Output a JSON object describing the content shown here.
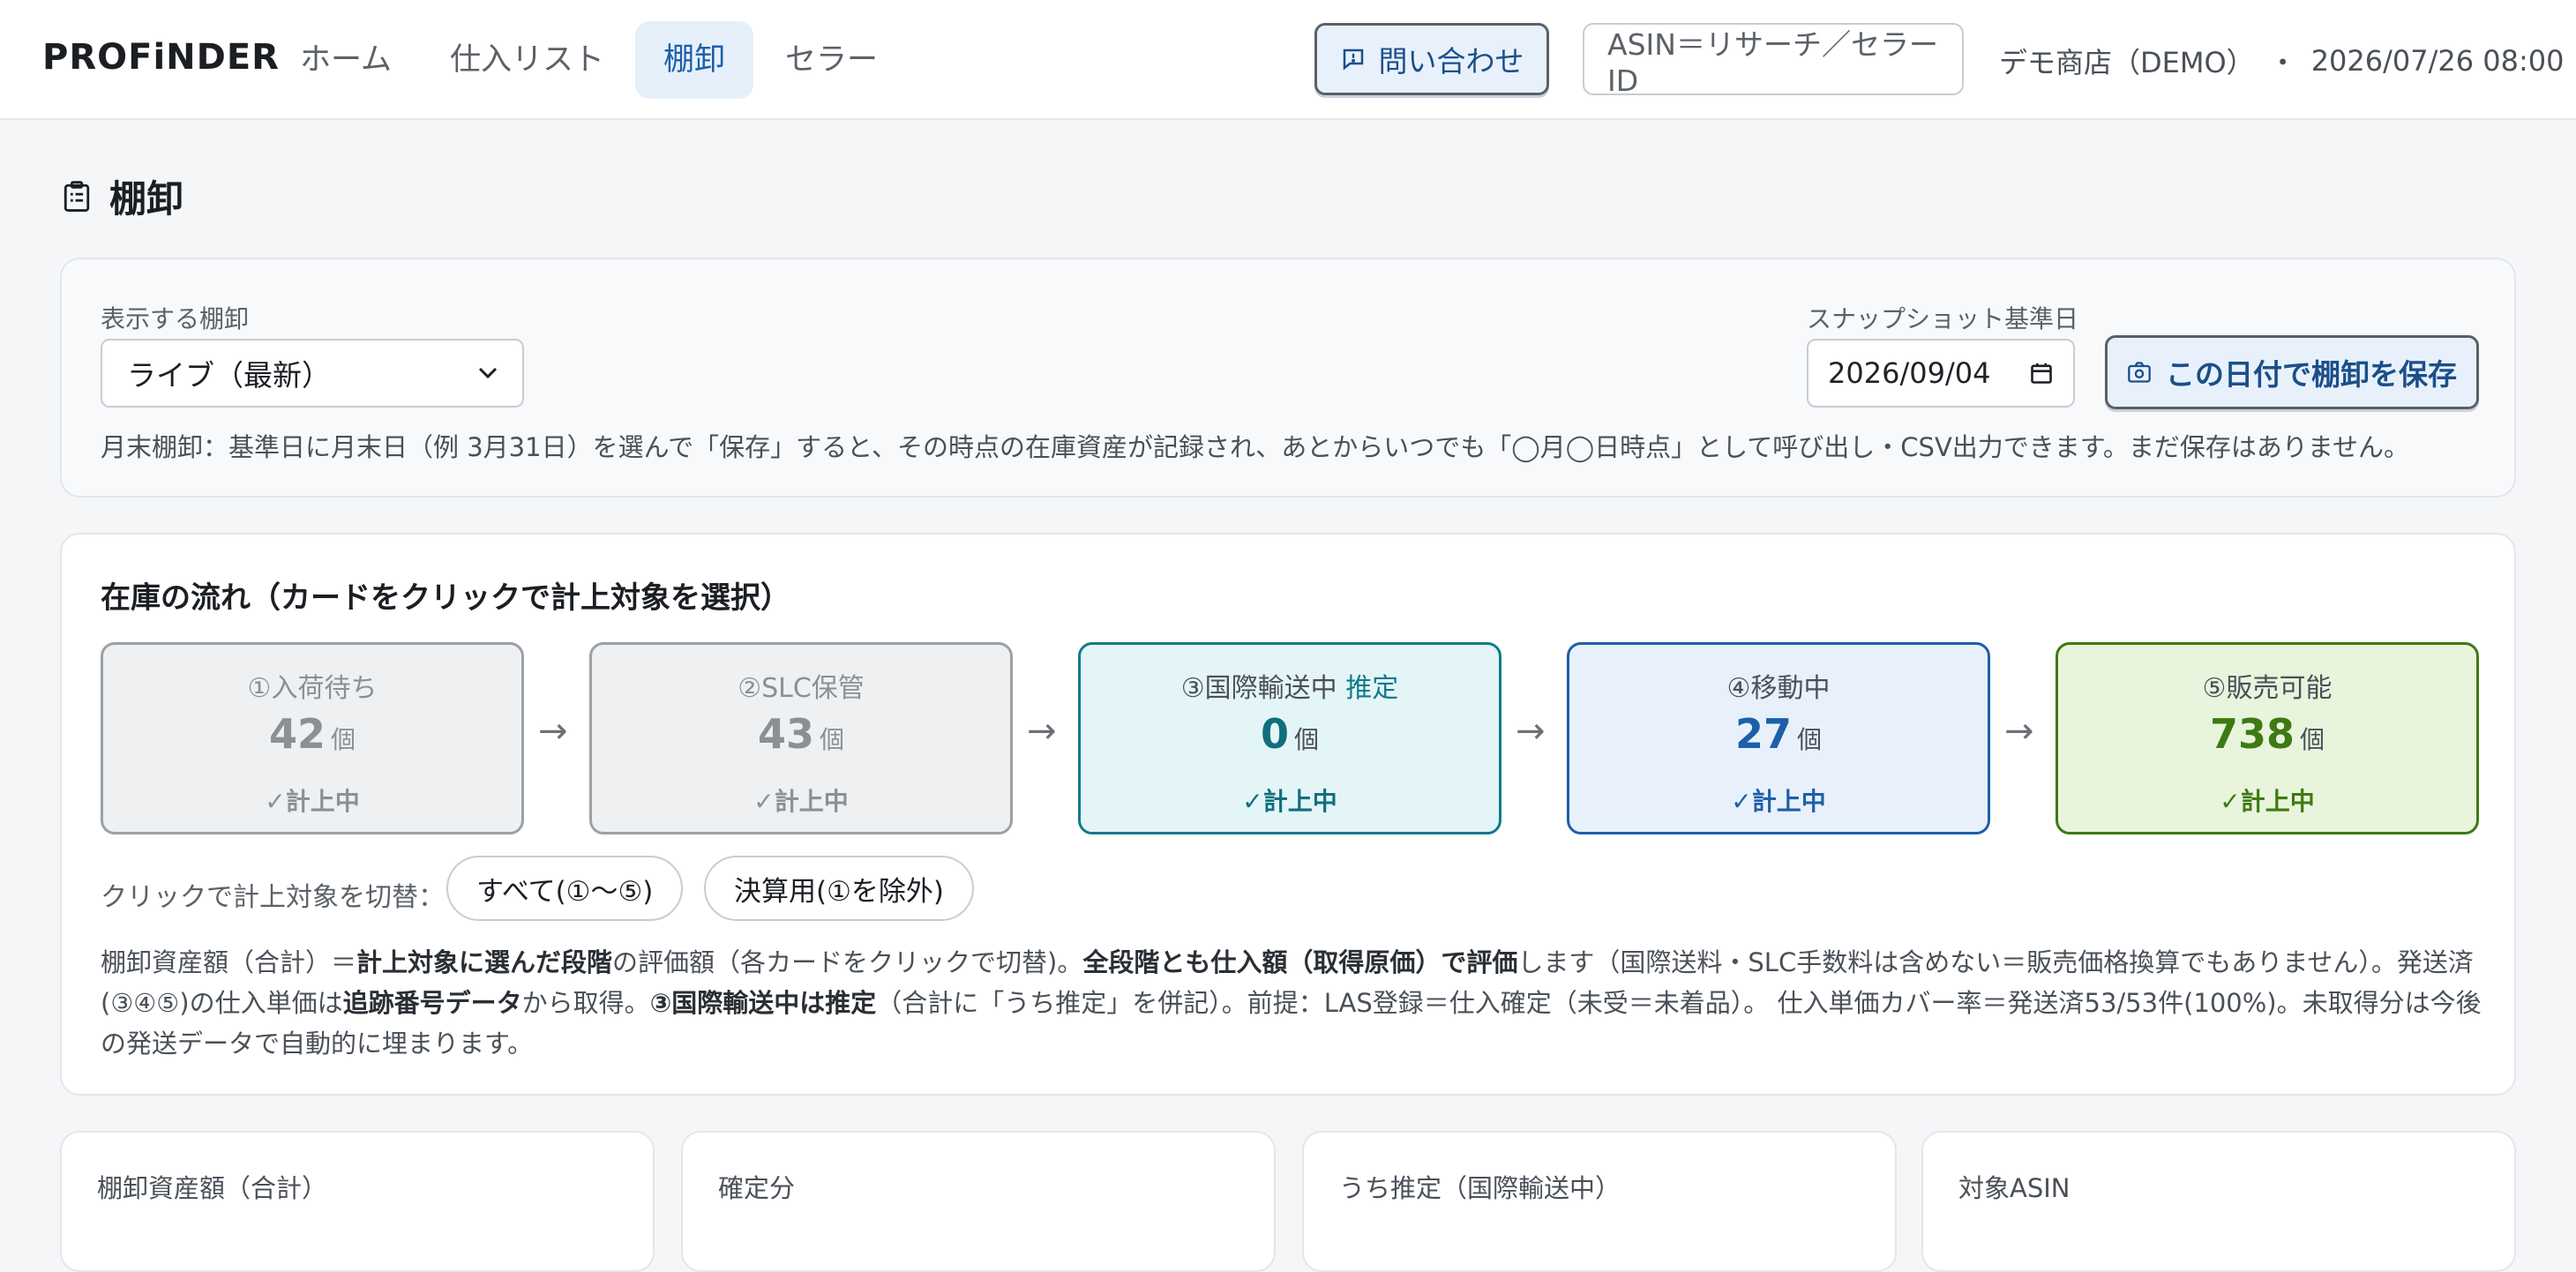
{
  "nav": {
    "logo": "PROFiNDER",
    "items": [
      {
        "label": "ホーム"
      },
      {
        "label": "仕入リスト"
      },
      {
        "label": "棚卸"
      },
      {
        "label": "セラー"
      }
    ],
    "contact_button": "問い合わせ",
    "search_placeholder": "ASIN＝リサーチ／セラーID",
    "shop": "デモ商店（DEMO）",
    "separator": "・",
    "datetime": "2026/07/26 08:00"
  },
  "page": {
    "title": "棚卸"
  },
  "snapshot_panel": {
    "view_label": "表示する棚卸",
    "view_selected": "ライブ（最新）",
    "date_label": "スナップショット基準日",
    "date_value": "2026/09/04",
    "save_button": "この日付で棚卸を保存",
    "note": "月末棚卸：基準日に月末日（例 3月31日）を選んで「保存」すると、その時点の在庫資産が記録され、あとからいつでも「◯月◯日時点」として呼び出し・CSV出力できます。まだ保存はありません。"
  },
  "flow_panel": {
    "title": "在庫の流れ（カードをクリックで計上対象を選択）",
    "unit": "個",
    "stages": [
      {
        "name": "①入荷待ち",
        "estimate_tag": "",
        "count": "42",
        "status": "✓計上中"
      },
      {
        "name": "②SLC保管",
        "estimate_tag": "",
        "count": "43",
        "status": "✓計上中"
      },
      {
        "name": "③国際輸送中",
        "estimate_tag": "推定",
        "count": "0",
        "status": "✓計上中"
      },
      {
        "name": "④移動中",
        "estimate_tag": "",
        "count": "27",
        "status": "✓計上中"
      },
      {
        "name": "⑤販売可能",
        "estimate_tag": "",
        "count": "738",
        "status": "✓計上中"
      }
    ],
    "arrow": "→",
    "toggle_label": "クリックで計上対象を切替：",
    "toggle_all": "すべて(①〜⑤)",
    "toggle_settlement": "決算用(①を除外)",
    "note": {
      "p1": "棚卸資産額（合計）＝",
      "b1": "計上対象に選んだ段階",
      "p2": "の評価額（各カードをクリックで切替)。",
      "b2": "全段階とも仕入額（取得原価）で評価",
      "p3": "します（国際送料・SLC手数料は含めない＝販売価格換算でもありません）。発送済(③④⑤)の仕入単価は",
      "b3": "追跡番号データ",
      "p4": "から取得。",
      "b4": "③国際輸送中は推定",
      "p5": "（合計に「うち推定」を併記）。前提：LAS登録＝仕入確定（未受＝未着品）。 仕入単価カバー率＝発送済53/53件(100%)。未取得分は今後の発送データで自動的に埋まります。"
    }
  },
  "stats": [
    {
      "label": "棚卸資産額（合計）"
    },
    {
      "label": "確定分"
    },
    {
      "label": "うち推定（国際輸送中）"
    },
    {
      "label": "対象ASIN"
    }
  ],
  "colors": {
    "accent": "#1d5fa8",
    "stage_pending": "#8a9096",
    "stage_transit": "#0f7b8a",
    "stage_moving": "#1d5fa8",
    "stage_sellable": "#3d7a12"
  }
}
